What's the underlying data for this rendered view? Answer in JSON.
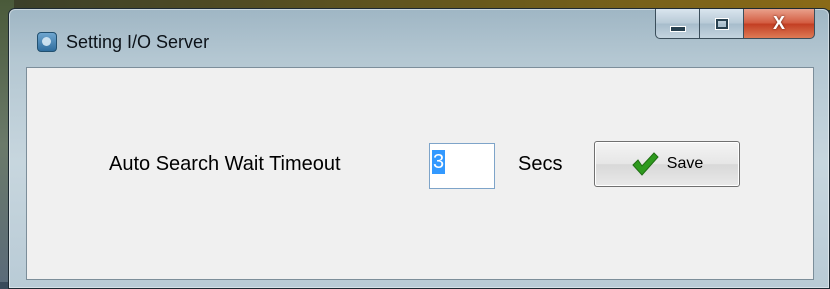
{
  "window": {
    "title": "Setting I/O Server",
    "icon": "app-icon",
    "caption_buttons": {
      "minimize_icon": "minimize-icon",
      "maximize_icon": "maximize-icon",
      "close_label": "X"
    }
  },
  "form": {
    "timeout_label": "Auto Search Wait Timeout",
    "timeout_value": "3",
    "units_label": "Secs",
    "save_label": "Save",
    "save_icon": "checkmark-icon"
  },
  "colors": {
    "selection": "#3399ff",
    "checkmark": "#2e9a1e",
    "close_button": "#c23d22"
  }
}
